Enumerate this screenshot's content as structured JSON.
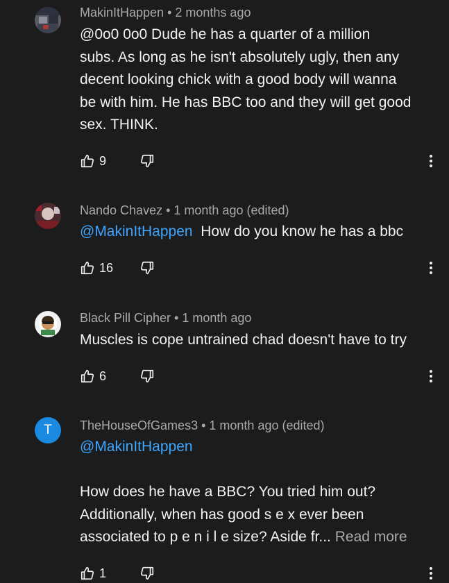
{
  "comments": [
    {
      "author": "MakinItHappen",
      "time": "2 months ago",
      "reply_to": "",
      "text_lines": [
        "@0o0 0o0  Dude he has a quarter of a million",
        "subs. As long as he isn't absolutely ugly, then any",
        "decent looking chick with a good body will wanna",
        "be with him. He has BBC too and they will get good",
        "sex. THINK."
      ],
      "likes": "9"
    },
    {
      "author": "Nando Chavez",
      "time": "1 month ago (edited)",
      "reply_to": "@MakinItHappen",
      "text": "How do you know he has a bbc",
      "likes": "16"
    },
    {
      "author": "Black Pill Cipher",
      "time": "1 month ago",
      "text": "Muscles is cope untrained chad doesn't have to try",
      "likes": "6"
    },
    {
      "author": "TheHouseOfGames3",
      "avatar_letter": "T",
      "time": "1 month ago (edited)",
      "reply_to": "@MakinItHappen",
      "text_lines": [
        "How does he have a BBC? You tried him out?",
        "Additionally, when has good s e x ever been",
        "associated to p e n i l e size? Aside fr..."
      ],
      "read_more": "Read more",
      "likes": "1"
    }
  ],
  "separator": "•",
  "icons": {
    "like": "thumbs-up-icon",
    "dislike": "thumbs-down-icon",
    "more": "more-vertical-icon"
  },
  "colors": {
    "background": "#1c1c1c",
    "mention": "#3ea6ff",
    "meta": "#aaaaaa",
    "avatar_letter_bg": "#1a8ae0"
  }
}
